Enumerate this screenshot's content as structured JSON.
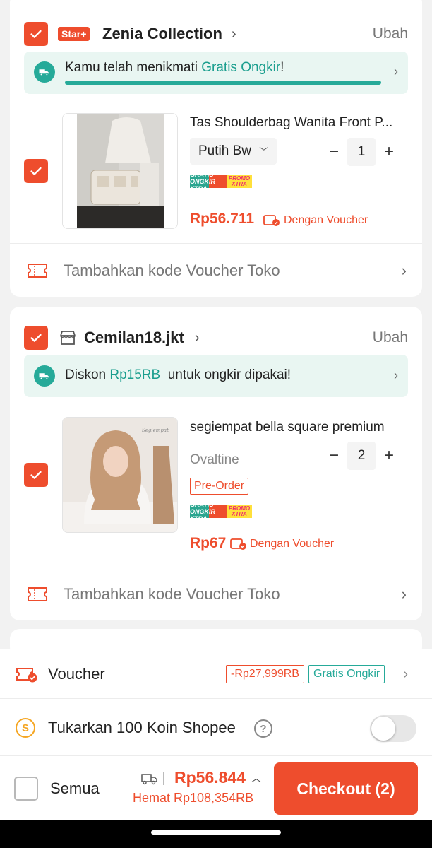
{
  "shops": [
    {
      "badge": "Star+",
      "name": "Zenia Collection",
      "edit_label": "Ubah",
      "shipping_prefix": "Kamu telah menikmati ",
      "shipping_highlight": "Gratis Ongkir",
      "shipping_suffix": "!",
      "shipping_progress": 1.0,
      "product": {
        "name": "Tas Shoulderbag Wanita Front P...",
        "variant": "Putih Bw",
        "quantity": "1",
        "price": "Rp56.711",
        "voucher_label": "Dengan Voucher",
        "promo_a": "GRATIS ONGKIR XTRA",
        "promo_b": "PROMO XTRA",
        "checked": true
      },
      "shop_voucher_label": "Tambahkan kode Voucher Toko"
    },
    {
      "name": "Cemilan18.jkt",
      "edit_label": "Ubah",
      "shipping_prefix": "Diskon ",
      "shipping_highlight": "Rp15RB",
      "shipping_suffix": "  untuk ongkir dipakai!",
      "product": {
        "name": "segiempat bella square premium",
        "variant": "Ovaltine",
        "quantity": "2",
        "preorder_label": "Pre-Order",
        "price": "Rp67",
        "voucher_label": "Dengan Voucher",
        "promo_a": "GRATIS ONGKIR XTRA",
        "promo_b": "PROMO XTRA",
        "checked": true
      },
      "shop_voucher_label": "Tambahkan kode Voucher Toko"
    }
  ],
  "bottom": {
    "voucher_label": "Voucher",
    "voucher_discount": "-Rp27,999RB",
    "voucher_free_shipping": "Gratis Ongkir",
    "coin_label": "Tukarkan 100 Koin Shopee",
    "coin_toggle_on": false,
    "select_all_label": "Semua",
    "total": "Rp56.844",
    "savings": "Hemat Rp108,354RB",
    "checkout_label": "Checkout (2)"
  },
  "colors": {
    "brand": "#ee4d2d",
    "teal": "#26aa99"
  }
}
